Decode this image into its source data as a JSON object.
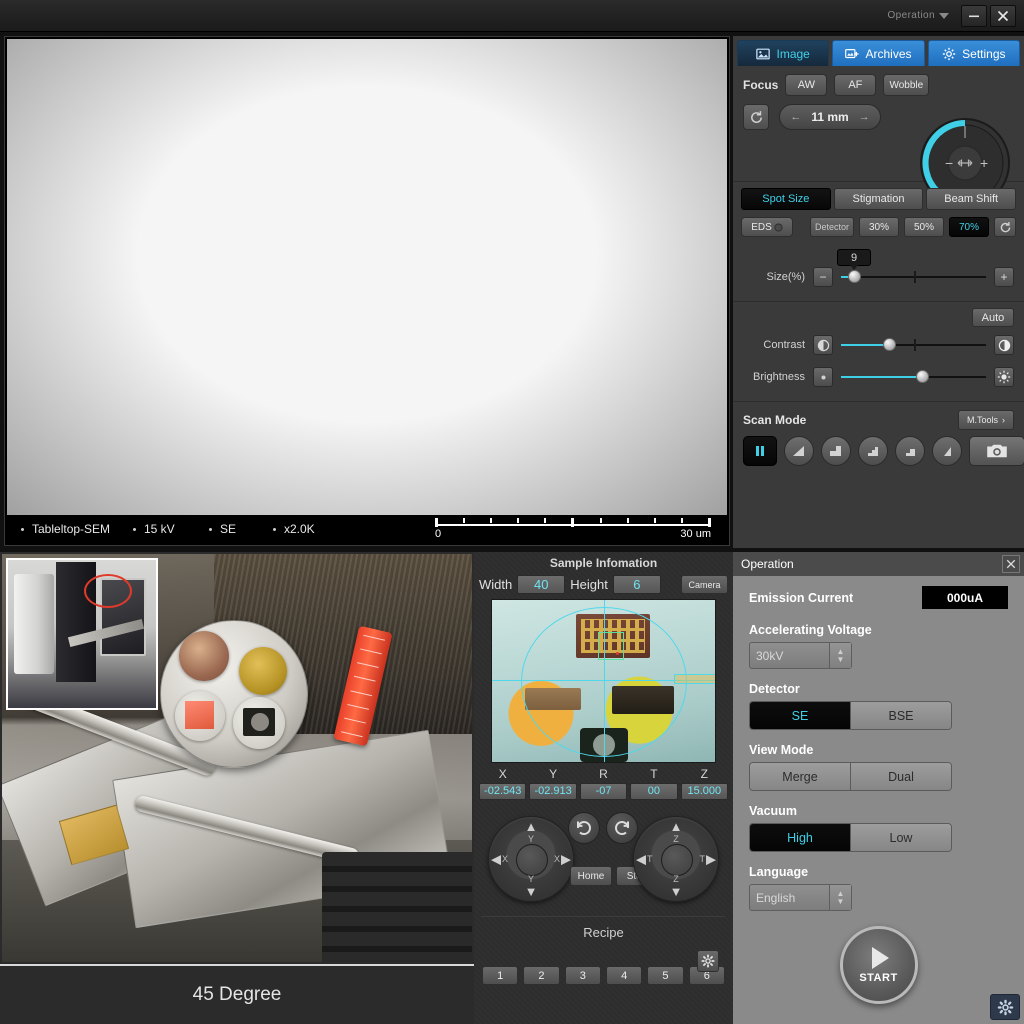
{
  "titlebar": {
    "operation_label": "Operation",
    "minimize_icon": "minimize-icon",
    "close_icon": "close-icon"
  },
  "sem_image": {
    "databar": {
      "instrument": "Tableltop-SEM",
      "voltage": "15 kV",
      "detector": "SE",
      "magnification": "x2.0K"
    },
    "scalebar": {
      "start": "0",
      "end": "30 um"
    }
  },
  "tabs": [
    {
      "label": "Image",
      "icon": "image-icon",
      "active": true
    },
    {
      "label": "Archives",
      "icon": "archives-add-icon",
      "active": false
    },
    {
      "label": "Settings",
      "icon": "gear-icon",
      "active": false
    }
  ],
  "focus": {
    "label": "Focus",
    "aw_label": "AW",
    "af_label": "AF",
    "wobble_label": "Wobble",
    "reset_icon": "reset-icon",
    "working_distance": "11 mm",
    "knob_minus": "−",
    "knob_plus": "+"
  },
  "beam_tabs": [
    {
      "label": "Spot Size",
      "active": true
    },
    {
      "label": "Stigmation",
      "active": false
    },
    {
      "label": "Beam Shift",
      "active": false
    }
  ],
  "detector_row": {
    "eds_label": "EDS",
    "detector_label": "Detector",
    "presets": [
      {
        "label": "30%",
        "active": false
      },
      {
        "label": "50%",
        "active": false
      },
      {
        "label": "70%",
        "active": true
      }
    ],
    "reset_icon": "reset-icon"
  },
  "spot_size": {
    "label": "Size(%)",
    "value": "9",
    "minus": "−",
    "plus": "+"
  },
  "image_adjust": {
    "auto_label": "Auto",
    "contrast": {
      "label": "Contrast",
      "percent": 33
    },
    "brightness": {
      "label": "Brightness",
      "percent": 56
    }
  },
  "scan_mode": {
    "title": "Scan Mode",
    "mtools_label": "M.Tools",
    "buttons": [
      {
        "name": "pause-scan-button",
        "icon": "pause-icon",
        "active": true
      },
      {
        "name": "scan-speed-1-button",
        "icon": "ramp-1-icon",
        "active": false
      },
      {
        "name": "scan-speed-2-button",
        "icon": "ramp-2-icon",
        "active": false
      },
      {
        "name": "scan-speed-3-button",
        "icon": "ramp-3-icon",
        "active": false
      },
      {
        "name": "scan-speed-4-button",
        "icon": "ramp-4-icon",
        "active": false
      },
      {
        "name": "scan-speed-5-button",
        "icon": "ramp-5-icon",
        "active": false
      },
      {
        "name": "capture-button",
        "icon": "camera-icon",
        "active": false
      }
    ]
  },
  "stage_photo": {
    "caption": "45 Degree"
  },
  "sample_info": {
    "title": "Sample Infomation",
    "width_label": "Width",
    "width_value": "40",
    "height_label": "Height",
    "height_value": "6",
    "camera_label": "Camera",
    "coords": [
      {
        "axis": "X",
        "value": "-02.543"
      },
      {
        "axis": "Y",
        "value": "-02.913"
      },
      {
        "axis": "R",
        "value": "-07"
      },
      {
        "axis": "T",
        "value": "00"
      },
      {
        "axis": "Z",
        "value": "15.000"
      }
    ]
  },
  "stage_controls": {
    "xy_pad": {
      "up": "Y",
      "down": "Y",
      "left": "X",
      "right": "X"
    },
    "tz_pad": {
      "up": "Z",
      "down": "Z",
      "left": "T",
      "right": "T"
    },
    "rotate_cw_icon": "rotate-cw-icon",
    "rotate_ccw_icon": "rotate-ccw-icon",
    "home_label": "Home",
    "stop_label": "Stop"
  },
  "recipe": {
    "title": "Recipe",
    "gear_icon": "gear-icon",
    "slots": [
      "1",
      "2",
      "3",
      "4",
      "5",
      "6"
    ]
  },
  "operation": {
    "title": "Operation",
    "close_icon": "close-icon",
    "emission_current_label": "Emission Current",
    "emission_current_value": "000uA",
    "accelerating_voltage_label": "Accelerating Voltage",
    "accelerating_voltage_value": "30kV",
    "detector_label": "Detector",
    "detector_options": [
      {
        "label": "SE",
        "active": true
      },
      {
        "label": "BSE",
        "active": false
      }
    ],
    "view_mode_label": "View Mode",
    "view_mode_options": [
      {
        "label": "Merge",
        "active": false
      },
      {
        "label": "Dual",
        "active": false
      }
    ],
    "vacuum_label": "Vacuum",
    "vacuum_options": [
      {
        "label": "High",
        "active": true
      },
      {
        "label": "Low",
        "active": false
      }
    ],
    "language_label": "Language",
    "language_value": "English",
    "start_label": "START",
    "start_icon": "play-icon",
    "settings_gear_icon": "gear-icon"
  },
  "colors": {
    "accent_cyan": "#3fd0e8",
    "tab_blue": "#2b7fd0",
    "panel_dark": "#3a3a3a",
    "panel_light": "#8a8a8a"
  }
}
